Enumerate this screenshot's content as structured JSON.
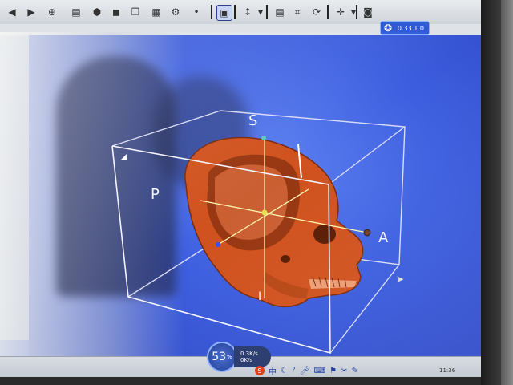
{
  "toolbar": {
    "zoom_label": "0.33 1.0",
    "icons": [
      "back-icon",
      "forward-icon",
      "screenshot-icon",
      "cube-icon",
      "camera-icon",
      "layers-icon",
      "settings-icon",
      "select-icon",
      "arrow-icon",
      "zoom-icon",
      "measure-icon",
      "rotate-icon",
      "move-icon",
      "record-icon",
      "view-icon"
    ]
  },
  "viewport": {
    "orient_superior": "S",
    "orient_posterior": "P",
    "orient_anterior": "A",
    "orient_inferior": "I"
  },
  "perf": {
    "value": "53",
    "unit": "%",
    "up": "0.3K/s",
    "down": "0K/s"
  },
  "tray": {
    "ime_label": "S",
    "ime_mode": "中"
  },
  "taskbar": {
    "clock": "11:36"
  },
  "colors": {
    "viewport_blue": "#3d5fe0",
    "skull": "#d4541f",
    "bbox": "#f0f0ff",
    "crosshair": "#f5e86a"
  }
}
